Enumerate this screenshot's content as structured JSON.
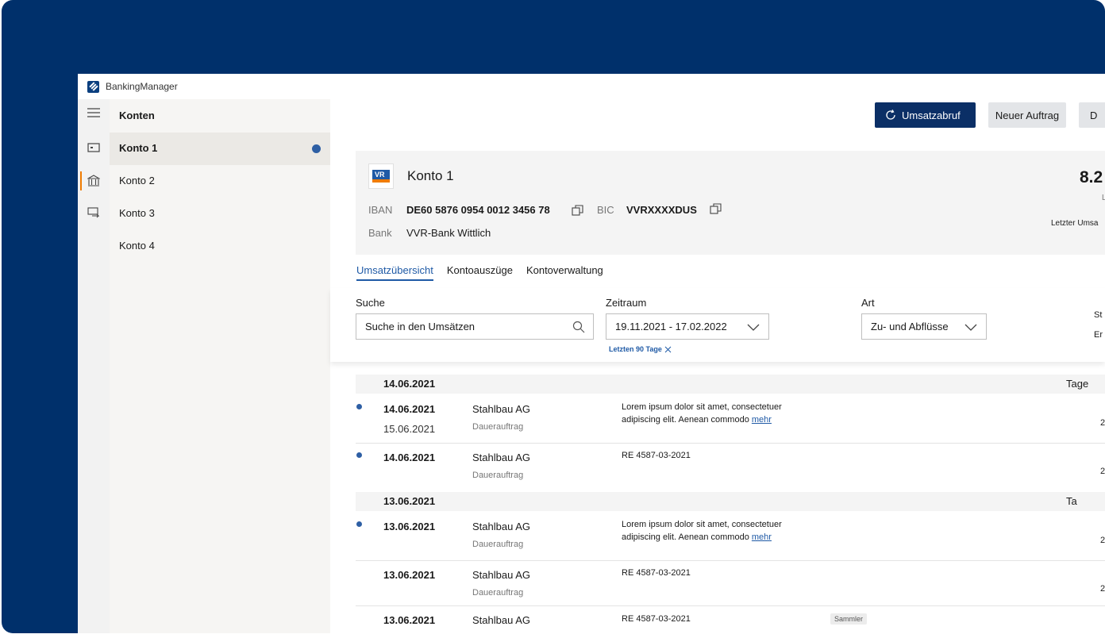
{
  "app": {
    "title": "BankingManager"
  },
  "sidebar": {
    "title": "Konten",
    "items": [
      {
        "label": "Konto 1",
        "active": true,
        "unread": true
      },
      {
        "label": "Konto 2"
      },
      {
        "label": "Konto 3"
      },
      {
        "label": "Konto 4"
      }
    ]
  },
  "toolbar": {
    "primary_label": "Umsatzabruf",
    "secondary_label": "Neuer Auftrag",
    "third_label_partial": "D"
  },
  "account": {
    "name": "Konto 1",
    "iban_label": "IBAN",
    "iban": "DE60 5876 0954 0012 3456 78",
    "bic_label": "BIC",
    "bic": "VVRXXXXDUS",
    "bank_label": "Bank",
    "bank": "VVR-Bank Wittlich",
    "balance_partial": "8.2",
    "balance_sub_partial": "L",
    "last_update_partial": "Letzter Umsa"
  },
  "tabs": [
    {
      "label": "Umsatzübersicht",
      "active": true
    },
    {
      "label": "Kontoauszüge"
    },
    {
      "label": "Kontoverwaltung"
    }
  ],
  "filters": {
    "search_label": "Suche",
    "search_placeholder": "Suche in den Umsätzen",
    "period_label": "Zeitraum",
    "period_value": "19.11.2021 - 17.02.2022",
    "period_chip": "Letzten 90 Tage",
    "type_label": "Art",
    "type_value": "Zu- und Abflüsse",
    "edge_1": "St",
    "edge_2": "Er"
  },
  "groups": [
    {
      "date": "14.06.2021",
      "right_partial": "Tage",
      "transactions": [
        {
          "date": "14.06.2021",
          "valuta": "15.06.2021",
          "party": "Stahlbau AG",
          "type": "Dauerauftrag",
          "desc": "Lorem ipsum dolor sit amet, consectetuer adipiscing elit. Aenean commodo",
          "more": "mehr",
          "unread": true,
          "edge": "2"
        },
        {
          "date": "14.06.2021",
          "party": "Stahlbau AG",
          "type": "Dauerauftrag",
          "desc": "RE 4587-03-2021",
          "unread": true,
          "edge": "2"
        }
      ]
    },
    {
      "date": "13.06.2021",
      "right_partial": "Ta",
      "transactions": [
        {
          "date": "13.06.2021",
          "party": "Stahlbau AG",
          "type": "Dauerauftrag",
          "desc": "Lorem ipsum dolor sit amet, consectetuer adipiscing elit. Aenean commodo",
          "more": "mehr",
          "unread": true,
          "edge": "2"
        },
        {
          "date": "13.06.2021",
          "party": "Stahlbau AG",
          "type": "Dauerauftrag",
          "desc": "RE 4587-03-2021",
          "edge": "2"
        },
        {
          "date": "13.06.2021",
          "party": "Stahlbau AG",
          "desc": "RE 4587-03-2021",
          "badge": "Sammler"
        }
      ]
    }
  ],
  "colors": {
    "navy": "#00306b",
    "primary": "#0b2f66",
    "link": "#1f5aa6",
    "accent": "#f07c00"
  }
}
